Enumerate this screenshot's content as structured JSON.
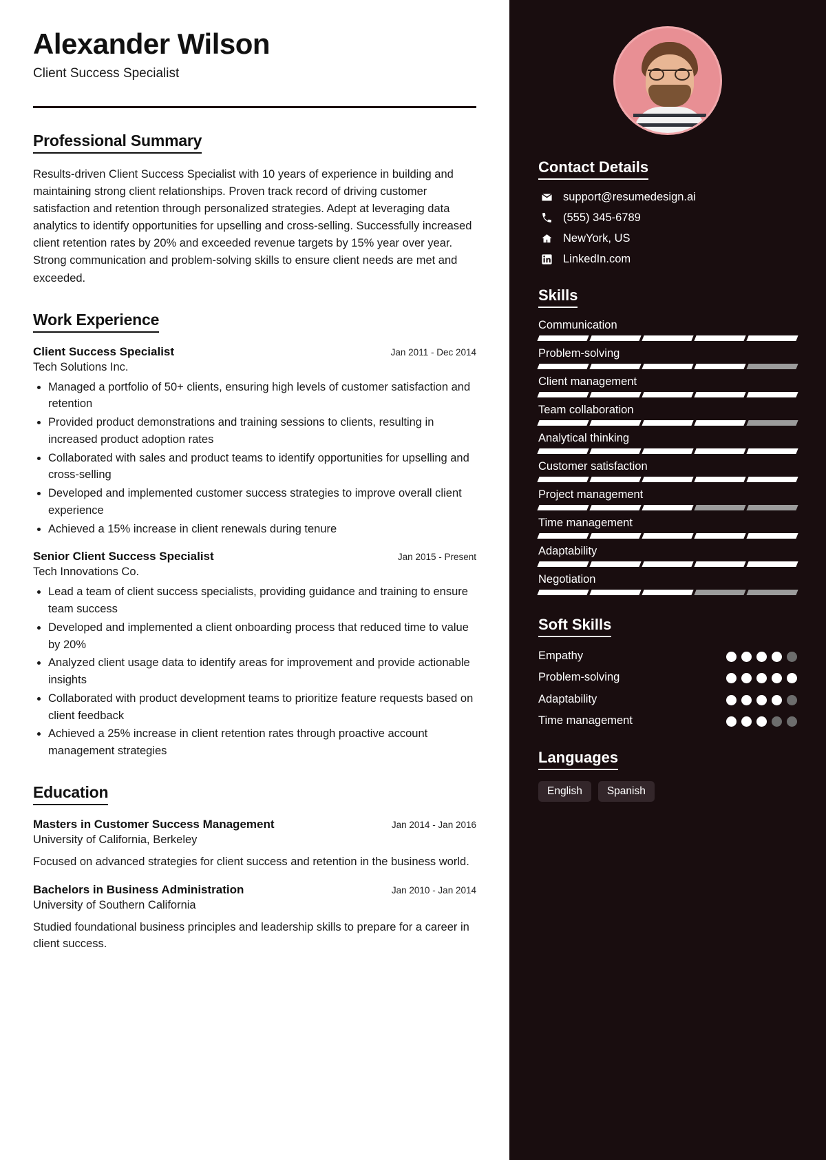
{
  "header": {
    "name": "Alexander Wilson",
    "job_title": "Client Success Specialist"
  },
  "summary": {
    "heading": "Professional Summary",
    "text": "Results-driven Client Success Specialist with 10 years of experience in building and maintaining strong client relationships. Proven track record of driving customer satisfaction and retention through personalized strategies. Adept at leveraging data analytics to identify opportunities for upselling and cross-selling. Successfully increased client retention rates by 20% and exceeded revenue targets by 15% year over year. Strong communication and problem-solving skills to ensure client needs are met and exceeded."
  },
  "work": {
    "heading": "Work Experience",
    "entries": [
      {
        "role": "Client Success Specialist",
        "date": "Jan 2011 - Dec 2014",
        "org": "Tech Solutions Inc.",
        "bullets": [
          "Managed a portfolio of 50+ clients, ensuring high levels of customer satisfaction and retention",
          "Provided product demonstrations and training sessions to clients, resulting in increased product adoption rates",
          "Collaborated with sales and product teams to identify opportunities for upselling and cross-selling",
          "Developed and implemented customer success strategies to improve overall client experience",
          "Achieved a 15% increase in client renewals during tenure"
        ]
      },
      {
        "role": "Senior Client Success Specialist",
        "date": "Jan 2015 - Present",
        "org": "Tech Innovations Co.",
        "bullets": [
          "Lead a team of client success specialists, providing guidance and training to ensure team success",
          "Developed and implemented a client onboarding process that reduced time to value by 20%",
          "Analyzed client usage data to identify areas for improvement and provide actionable insights",
          "Collaborated with product development teams to prioritize feature requests based on client feedback",
          "Achieved a 25% increase in client retention rates through proactive account management strategies"
        ]
      }
    ]
  },
  "education": {
    "heading": "Education",
    "entries": [
      {
        "degree": "Masters in Customer Success Management",
        "date": "Jan 2014 - Jan 2016",
        "school": "University of California, Berkeley",
        "description": "Focused on advanced strategies for client success and retention in the business world."
      },
      {
        "degree": "Bachelors in Business Administration",
        "date": "Jan 2010 - Jan 2014",
        "school": "University of Southern California",
        "description": "Studied foundational business principles and leadership skills to prepare for a career in client success."
      }
    ]
  },
  "contact": {
    "heading": "Contact Details",
    "items": [
      {
        "icon": "envelope-icon",
        "value": "support@resumedesign.ai"
      },
      {
        "icon": "phone-icon",
        "value": "(555) 345-6789"
      },
      {
        "icon": "home-icon",
        "value": "NewYork, US"
      },
      {
        "icon": "linkedin-icon",
        "value": "LinkedIn.com"
      }
    ]
  },
  "skills": {
    "heading": "Skills",
    "segments_total": 5,
    "items": [
      {
        "name": "Communication",
        "filled": 5
      },
      {
        "name": "Problem-solving",
        "filled": 4
      },
      {
        "name": "Client management",
        "filled": 5
      },
      {
        "name": "Team collaboration",
        "filled": 4
      },
      {
        "name": "Analytical thinking",
        "filled": 5
      },
      {
        "name": "Customer satisfaction",
        "filled": 5
      },
      {
        "name": "Project management",
        "filled": 3
      },
      {
        "name": "Time management",
        "filled": 5
      },
      {
        "name": "Adaptability",
        "filled": 5
      },
      {
        "name": "Negotiation",
        "filled": 3
      }
    ]
  },
  "soft_skills": {
    "heading": "Soft Skills",
    "dots_total": 5,
    "items": [
      {
        "name": "Empathy",
        "filled": 4
      },
      {
        "name": "Problem-solving",
        "filled": 5
      },
      {
        "name": "Adaptability",
        "filled": 4
      },
      {
        "name": "Time management",
        "filled": 3
      }
    ]
  },
  "languages": {
    "heading": "Languages",
    "items": [
      "English",
      "Spanish"
    ]
  },
  "colors": {
    "sidebar_bg": "#190d0f",
    "accent_avatar": "#e88f94",
    "meter_on": "#ffffff",
    "meter_off": "#9c9c9c",
    "pill_bg": "#33262a"
  }
}
